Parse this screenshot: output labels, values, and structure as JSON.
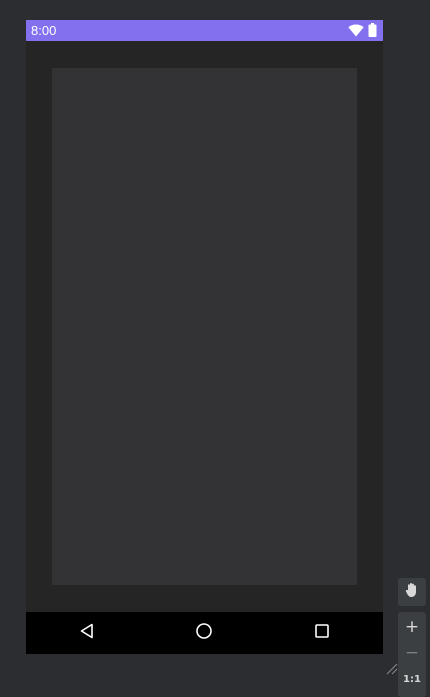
{
  "status_bar": {
    "time": "8:00",
    "icons": [
      "wifi-icon",
      "battery-icon"
    ],
    "background_color": "#8370ee"
  },
  "navigation_bar": {
    "buttons": [
      "back-icon",
      "home-icon",
      "recents-icon"
    ]
  },
  "preview_tools": {
    "pan_icon": "hand-icon",
    "zoom_in_label": "+",
    "zoom_out_label": "−",
    "zoom_reset_label": "1:1"
  },
  "colors": {
    "workspace": "#2b2d30",
    "device_background": "#252525",
    "card": "#333335",
    "nav_bar": "#000000"
  }
}
